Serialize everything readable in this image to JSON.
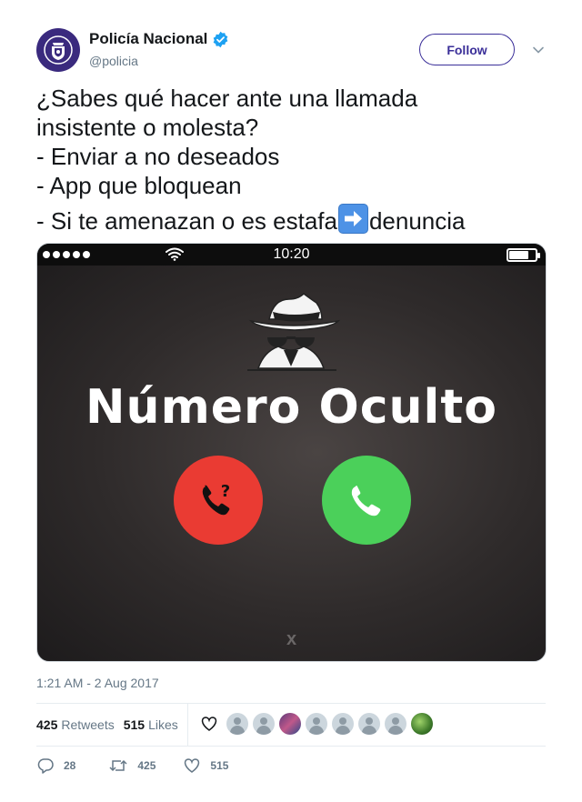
{
  "account": {
    "display_name": "Policía Nacional",
    "handle": "@policia",
    "verified_icon": "verified-badge-icon",
    "follow_label": "Follow"
  },
  "tweet": {
    "lines": [
      "¿Sabes qué hacer ante una llamada",
      "insistente o molesta?",
      "- Enviar a no deseados",
      "- App que bloquean"
    ],
    "last_line_before": "- Si te amenazan o es estafa",
    "last_line_emoji": "right-arrow-emoji",
    "last_line_after": "denuncia"
  },
  "media": {
    "clock": "10:20",
    "caller_title": "Número Oculto",
    "close_mark": "x",
    "battery_level": 0.7
  },
  "timestamp": "1:21 AM - 2 Aug 2017",
  "stats": {
    "retweets_count": "425",
    "retweets_label": "Retweets",
    "likes_count": "515",
    "likes_label": "Likes"
  },
  "actions": {
    "reply_count": "28",
    "retweet_count": "425",
    "like_count": "515"
  },
  "colors": {
    "accent": "#3b2f99",
    "verified": "#1da1f2",
    "decline": "#ea3b33",
    "accept": "#4bd05a"
  }
}
